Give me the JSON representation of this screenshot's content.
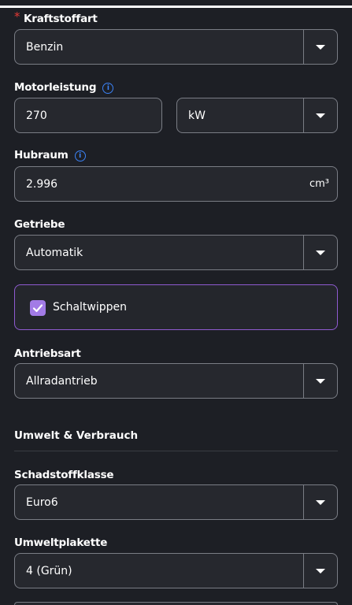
{
  "fields": {
    "kraftstoffart": {
      "label": "Kraftstoffart",
      "required_marker": "*",
      "value": "Benzin"
    },
    "motorleistung": {
      "label": "Motorleistung",
      "value": "270",
      "unit_value": "kW"
    },
    "hubraum": {
      "label": "Hubraum",
      "value": "2.996",
      "unit": "cm³"
    },
    "getriebe": {
      "label": "Getriebe",
      "value": "Automatik"
    },
    "schaltwippen": {
      "label": "Schaltwippen",
      "checked": true
    },
    "antriebsart": {
      "label": "Antriebsart",
      "value": "Allradantrieb"
    },
    "schadstoffklasse": {
      "label": "Schadstoffklasse",
      "value": "Euro6"
    },
    "umweltplakette": {
      "label": "Umweltplakette",
      "value": "4 (Grün)"
    }
  },
  "sections": {
    "umwelt": "Umwelt & Verbrauch"
  },
  "icons": {
    "info": "info-icon",
    "dropdown": "chevron-down-icon",
    "check": "check-icon"
  },
  "colors": {
    "background": "#1d1f25",
    "accent": "#a27be6",
    "required": "#e53935",
    "info": "#3b82f6"
  }
}
